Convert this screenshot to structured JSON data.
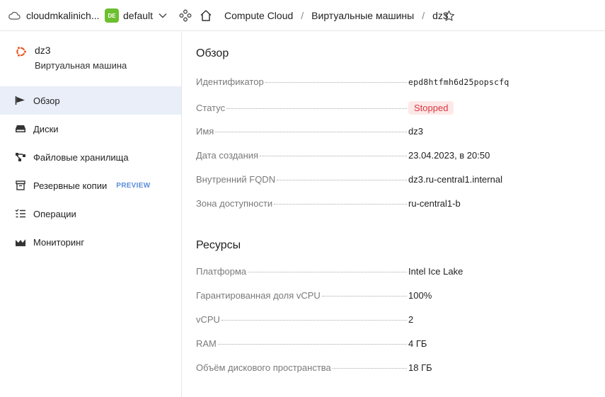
{
  "header": {
    "cloud_label": "cloudmkalinich...",
    "folder_badge": "DE",
    "folder_label": "default",
    "breadcrumbs": [
      "Compute Cloud",
      "Виртуальные машины",
      "dz3"
    ],
    "separator": "/"
  },
  "vm": {
    "name": "dz3",
    "type": "Виртуальная машина"
  },
  "nav": {
    "items": [
      {
        "label": "Обзор",
        "icon": "flag-icon"
      },
      {
        "label": "Диски",
        "icon": "disk-icon"
      },
      {
        "label": "Файловые хранилища",
        "icon": "file-storage-icon"
      },
      {
        "label": "Резервные копии",
        "icon": "archive-icon",
        "badge": "PREVIEW"
      },
      {
        "label": "Операции",
        "icon": "list-icon"
      },
      {
        "label": "Мониторинг",
        "icon": "chart-icon"
      }
    ]
  },
  "overview": {
    "title": "Обзор",
    "rows": [
      {
        "label": "Идентификатор",
        "value": "epd8htfmh6d25popscfq"
      },
      {
        "label": "Статус",
        "value": "Stopped"
      },
      {
        "label": "Имя",
        "value": "dz3"
      },
      {
        "label": "Дата создания",
        "value": "23.04.2023, в 20:50"
      },
      {
        "label": "Внутренний FQDN",
        "value": "dz3.ru-central1.internal"
      },
      {
        "label": "Зона доступности",
        "value": "ru-central1-b"
      }
    ]
  },
  "resources": {
    "title": "Ресурсы",
    "rows": [
      {
        "label": "Платформа",
        "value": "Intel Ice Lake"
      },
      {
        "label": "Гарантированная доля vCPU",
        "value": "100%"
      },
      {
        "label": "vCPU",
        "value": "2"
      },
      {
        "label": "RAM",
        "value": "4 ГБ"
      },
      {
        "label": "Объём дискового пространства",
        "value": "18 ГБ"
      }
    ]
  },
  "colors": {
    "accent": "#6cbf2e",
    "active_nav": "#e9eef8",
    "status_stopped_bg": "#fde8e8",
    "status_stopped_text": "#d9363e",
    "preview": "#5b8dd9"
  }
}
